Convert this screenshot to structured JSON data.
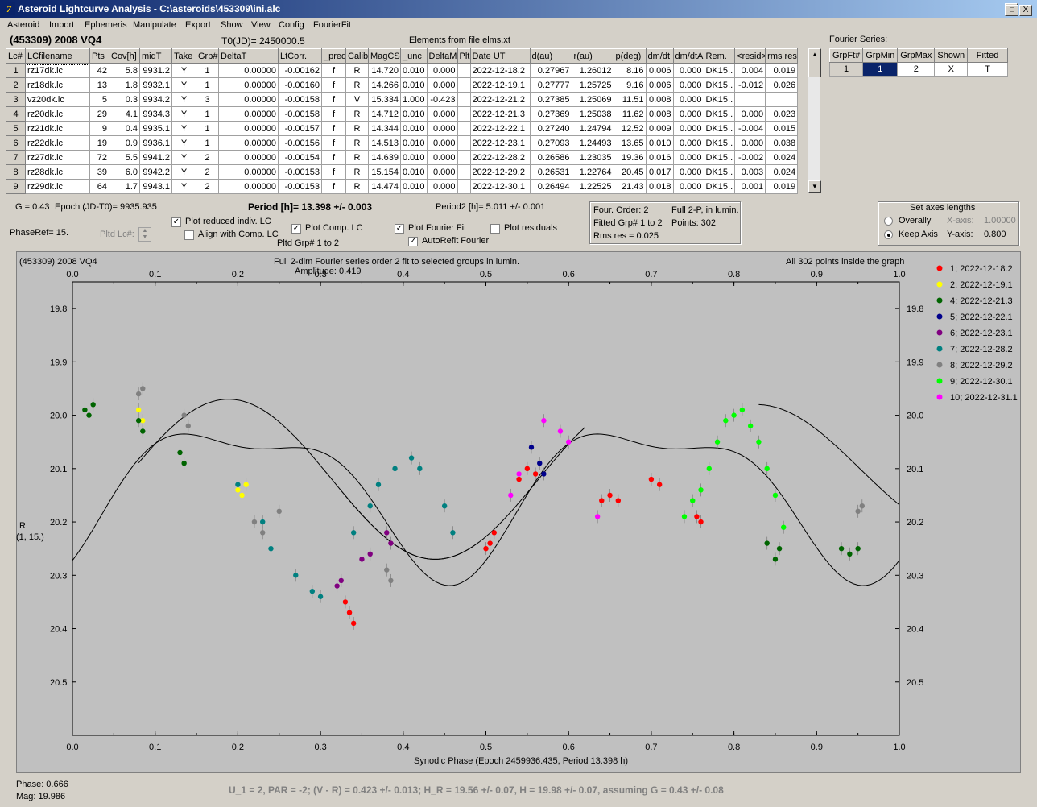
{
  "window": {
    "title": "Asteroid Lightcurve Analysis - C:\\asteroids\\453309\\ini.alc",
    "min": "_",
    "max": "□",
    "close": "X"
  },
  "menu": [
    "Asteroid",
    "Import",
    "Ephemeris",
    "Manipulate",
    "Export",
    "Show",
    "View",
    "Config",
    "FourierFit"
  ],
  "header": {
    "object": "(453309) 2008 VQ4",
    "t0": "T0(JD)= 2450000.5",
    "elements": "Elements from file elms.xt",
    "fourier_label": "Fourier Series:"
  },
  "grid": {
    "columns": [
      "Lc#",
      "LCfilename",
      "Pts",
      "Cov[h]",
      "midT",
      "Take",
      "Grp#",
      "DeltaT",
      "LtCorr.",
      "_pred.",
      "Calib.",
      "MagCS",
      "_unc",
      "DeltaM",
      "Plt",
      "Date UT",
      "d(au)",
      "r(au)",
      "p(deg)",
      "dm/dt",
      "dm/dtA",
      "Rem.",
      "<resid>",
      "rms res"
    ],
    "rows": [
      [
        "1",
        "rz17dk.lc",
        "42",
        "5.8",
        "9931.2",
        "Y",
        "1",
        "0.00000",
        "-0.00162",
        "f",
        "R",
        "14.720",
        "0.010",
        "0.000",
        "",
        "2022-12-18.2",
        "0.27967",
        "1.26012",
        "8.16",
        "0.006",
        "0.000",
        "DK15..",
        "0.004",
        "0.019"
      ],
      [
        "2",
        "rz18dk.lc",
        "13",
        "1.8",
        "9932.1",
        "Y",
        "1",
        "0.00000",
        "-0.00160",
        "f",
        "R",
        "14.266",
        "0.010",
        "0.000",
        "",
        "2022-12-19.1",
        "0.27777",
        "1.25725",
        "9.16",
        "0.006",
        "0.000",
        "DK15..",
        "-0.012",
        "0.026"
      ],
      [
        "3",
        "vz20dk.lc",
        "5",
        "0.3",
        "9934.2",
        "Y",
        "3",
        "0.00000",
        "-0.00158",
        "f",
        "V",
        "15.334",
        "1.000",
        "-0.423",
        "",
        "2022-12-21.2",
        "0.27385",
        "1.25069",
        "11.51",
        "0.008",
        "0.000",
        "DK15..",
        "",
        ""
      ],
      [
        "4",
        "rz20dk.lc",
        "29",
        "4.1",
        "9934.3",
        "Y",
        "1",
        "0.00000",
        "-0.00158",
        "f",
        "R",
        "14.712",
        "0.010",
        "0.000",
        "",
        "2022-12-21.3",
        "0.27369",
        "1.25038",
        "11.62",
        "0.008",
        "0.000",
        "DK15..",
        "0.000",
        "0.023"
      ],
      [
        "5",
        "rz21dk.lc",
        "9",
        "0.4",
        "9935.1",
        "Y",
        "1",
        "0.00000",
        "-0.00157",
        "f",
        "R",
        "14.344",
        "0.010",
        "0.000",
        "",
        "2022-12-22.1",
        "0.27240",
        "1.24794",
        "12.52",
        "0.009",
        "0.000",
        "DK15..",
        "-0.004",
        "0.015"
      ],
      [
        "6",
        "rz22dk.lc",
        "19",
        "0.9",
        "9936.1",
        "Y",
        "1",
        "0.00000",
        "-0.00156",
        "f",
        "R",
        "14.513",
        "0.010",
        "0.000",
        "",
        "2022-12-23.1",
        "0.27093",
        "1.24493",
        "13.65",
        "0.010",
        "0.000",
        "DK15..",
        "0.000",
        "0.038"
      ],
      [
        "7",
        "rz27dk.lc",
        "72",
        "5.5",
        "9941.2",
        "Y",
        "2",
        "0.00000",
        "-0.00154",
        "f",
        "R",
        "14.639",
        "0.010",
        "0.000",
        "",
        "2022-12-28.2",
        "0.26586",
        "1.23035",
        "19.36",
        "0.016",
        "0.000",
        "DK15..",
        "-0.002",
        "0.024"
      ],
      [
        "8",
        "rz28dk.lc",
        "39",
        "6.0",
        "9942.2",
        "Y",
        "2",
        "0.00000",
        "-0.00153",
        "f",
        "R",
        "15.154",
        "0.010",
        "0.000",
        "",
        "2022-12-29.2",
        "0.26531",
        "1.22764",
        "20.45",
        "0.017",
        "0.000",
        "DK15..",
        "0.003",
        "0.024"
      ],
      [
        "9",
        "rz29dk.lc",
        "64",
        "1.7",
        "9943.1",
        "Y",
        "2",
        "0.00000",
        "-0.00153",
        "f",
        "R",
        "14.474",
        "0.010",
        "0.000",
        "",
        "2022-12-30.1",
        "0.26494",
        "1.22525",
        "21.43",
        "0.018",
        "0.000",
        "DK15..",
        "0.001",
        "0.019"
      ]
    ]
  },
  "fourier_table": {
    "columns": [
      "GrpFt#",
      "GrpMin",
      "GrpMax",
      "Shown",
      "Fitted"
    ],
    "row": [
      "1",
      "1",
      "2",
      "X",
      "T"
    ]
  },
  "info": {
    "g": "G = 0.43",
    "epoch": "Epoch (JD-T0)= 9935.935",
    "period": "Period [h]= 13.398 +/- 0.003",
    "period2": "Period2 [h]= 5.011 +/- 0.001",
    "phaseref": "PhaseRef= 15.",
    "pltd_lc": "Pltd Lc#:",
    "pltd_grp": "Pltd Grp#  1   to   2"
  },
  "checks": {
    "reduced": "Plot reduced indiv. LC",
    "align": "Align with Comp. LC",
    "comp": "Plot Comp. LC",
    "fourier": "Plot Fourier Fit",
    "autorefit": "AutoRefit Fourier",
    "residuals": "Plot residuals"
  },
  "fitbox": {
    "order": "Four. Order:  2",
    "fitted": "Fitted Grp# 1 to 2",
    "rms": "Rms res      = 0.025",
    "full": "Full 2-P, in lumin.",
    "points": "Points: 302"
  },
  "axes_box": {
    "title": "Set axes lengths",
    "overall": "Overally",
    "keep": "Keep Axis",
    "xaxis": "X-axis:",
    "xval": "1.00000",
    "yaxis": "Y-axis:",
    "yval": "0.800"
  },
  "plot": {
    "object": "(453309) 2008 VQ4",
    "title1": "Full 2-dim Fourier series order 2 fit to selected groups in lumin.",
    "title2": "Amplitude: 0.419",
    "inside": "All 302 points inside the graph",
    "ylabel1": "R",
    "ylabel2": "(1, 15.)",
    "xlabel": "Synodic Phase (Epoch 2459936.435, Period 13.398 h)"
  },
  "status": {
    "phase": "Phase:  0.666",
    "mag": "Mag:     19.986",
    "bottom": "U_1 = 2, PAR = -2; (V - R) = 0.423 +/- 0.013; H_R = 19.56 +/- 0.07, H = 19.98 +/- 0.07, assuming G = 0.43 +/- 0.08"
  },
  "chart_data": {
    "type": "scatter",
    "xlim": [
      0,
      1
    ],
    "ylim": [
      20.6,
      19.75
    ],
    "x_ticks": [
      "0.0",
      "0.1",
      "0.2",
      "0.3",
      "0.4",
      "0.5",
      "0.6",
      "0.7",
      "0.8",
      "0.9",
      "1.0"
    ],
    "y_ticks": [
      "19.8",
      "19.9",
      "20.0",
      "20.1",
      "20.2",
      "20.3",
      "20.4",
      "20.5"
    ],
    "legend_position": "right",
    "series": [
      {
        "name": "1; 2022-12-18.2",
        "color": "#ff0000",
        "points": [
          [
            0.33,
            20.35
          ],
          [
            0.335,
            20.37
          ],
          [
            0.34,
            20.39
          ],
          [
            0.5,
            20.25
          ],
          [
            0.505,
            20.24
          ],
          [
            0.51,
            20.22
          ],
          [
            0.54,
            20.12
          ],
          [
            0.55,
            20.1
          ],
          [
            0.56,
            20.11
          ],
          [
            0.64,
            20.16
          ],
          [
            0.65,
            20.15
          ],
          [
            0.66,
            20.16
          ],
          [
            0.7,
            20.12
          ],
          [
            0.71,
            20.13
          ],
          [
            0.755,
            20.19
          ],
          [
            0.76,
            20.2
          ]
        ]
      },
      {
        "name": "2; 2022-12-19.1",
        "color": "#ffff00",
        "points": [
          [
            0.08,
            19.99
          ],
          [
            0.085,
            20.01
          ],
          [
            0.2,
            20.14
          ],
          [
            0.205,
            20.15
          ],
          [
            0.21,
            20.13
          ]
        ]
      },
      {
        "name": "4; 2022-12-21.3",
        "color": "#006400",
        "points": [
          [
            0.015,
            19.99
          ],
          [
            0.02,
            20.0
          ],
          [
            0.025,
            19.98
          ],
          [
            0.08,
            20.01
          ],
          [
            0.085,
            20.03
          ],
          [
            0.13,
            20.07
          ],
          [
            0.135,
            20.09
          ],
          [
            0.84,
            20.24
          ],
          [
            0.85,
            20.27
          ],
          [
            0.855,
            20.25
          ],
          [
            0.93,
            20.25
          ],
          [
            0.94,
            20.26
          ],
          [
            0.95,
            20.25
          ]
        ]
      },
      {
        "name": "5; 2022-12-22.1",
        "color": "#00008b",
        "points": [
          [
            0.555,
            20.06
          ],
          [
            0.565,
            20.09
          ],
          [
            0.57,
            20.11
          ]
        ]
      },
      {
        "name": "6; 2022-12-23.1",
        "color": "#800080",
        "points": [
          [
            0.32,
            20.32
          ],
          [
            0.325,
            20.31
          ],
          [
            0.35,
            20.27
          ],
          [
            0.36,
            20.26
          ],
          [
            0.38,
            20.22
          ],
          [
            0.385,
            20.24
          ]
        ]
      },
      {
        "name": "7; 2022-12-28.2",
        "color": "#008080",
        "points": [
          [
            0.2,
            20.13
          ],
          [
            0.23,
            20.2
          ],
          [
            0.24,
            20.25
          ],
          [
            0.27,
            20.3
          ],
          [
            0.29,
            20.33
          ],
          [
            0.3,
            20.34
          ],
          [
            0.34,
            20.22
          ],
          [
            0.36,
            20.17
          ],
          [
            0.37,
            20.13
          ],
          [
            0.39,
            20.1
          ],
          [
            0.41,
            20.08
          ],
          [
            0.42,
            20.1
          ],
          [
            0.45,
            20.17
          ],
          [
            0.46,
            20.22
          ]
        ]
      },
      {
        "name": "8; 2022-12-29.2",
        "color": "#808080",
        "points": [
          [
            0.08,
            19.96
          ],
          [
            0.085,
            19.95
          ],
          [
            0.135,
            20.0
          ],
          [
            0.14,
            20.02
          ],
          [
            0.22,
            20.2
          ],
          [
            0.23,
            20.22
          ],
          [
            0.25,
            20.18
          ],
          [
            0.38,
            20.29
          ],
          [
            0.385,
            20.31
          ],
          [
            0.95,
            20.18
          ],
          [
            0.955,
            20.17
          ]
        ]
      },
      {
        "name": "9; 2022-12-30.1",
        "color": "#00ff00",
        "points": [
          [
            0.74,
            20.19
          ],
          [
            0.75,
            20.16
          ],
          [
            0.76,
            20.14
          ],
          [
            0.77,
            20.1
          ],
          [
            0.78,
            20.05
          ],
          [
            0.79,
            20.01
          ],
          [
            0.8,
            20.0
          ],
          [
            0.81,
            19.99
          ],
          [
            0.82,
            20.02
          ],
          [
            0.83,
            20.05
          ],
          [
            0.84,
            20.1
          ],
          [
            0.85,
            20.15
          ],
          [
            0.86,
            20.21
          ]
        ]
      },
      {
        "name": "10; 2022-12-31.1",
        "color": "#ff00ff",
        "points": [
          [
            0.53,
            20.15
          ],
          [
            0.54,
            20.11
          ],
          [
            0.57,
            20.01
          ],
          [
            0.59,
            20.03
          ],
          [
            0.6,
            20.05
          ],
          [
            0.635,
            20.19
          ]
        ]
      }
    ]
  }
}
